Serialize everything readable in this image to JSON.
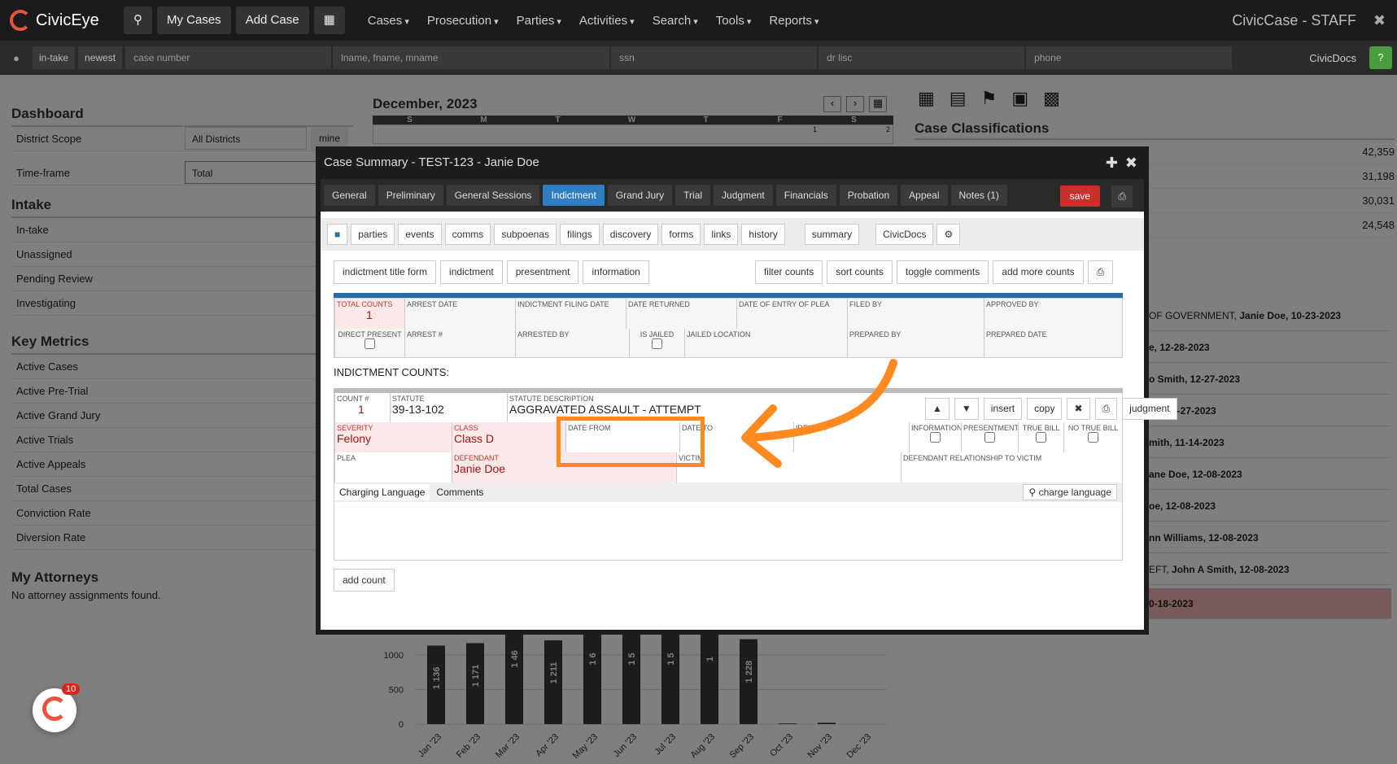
{
  "nav": {
    "brand": "CivicEye",
    "my_cases": "My Cases",
    "add_case": "Add Case",
    "menus": [
      "Cases",
      "Prosecution",
      "Parties",
      "Activities",
      "Search",
      "Tools",
      "Reports"
    ],
    "staff": "CivicCase - STAFF"
  },
  "search": {
    "intake": "in-take",
    "newest": "newest",
    "case_number": "case number",
    "name": "lname, fname, mname",
    "ssn": "ssn",
    "dr": "dr lisc",
    "phone": "phone",
    "civicdocs": "CivicDocs"
  },
  "dashboard": {
    "title": "Dashboard",
    "district_scope": "District Scope",
    "district_value": "All Districts",
    "mine": "mine",
    "timeframe": "Time-frame",
    "timeframe_value": "Total",
    "intake": "Intake",
    "intake_items": [
      "In-take",
      "Unassigned",
      "Pending Review",
      "Investigating"
    ],
    "key_metrics": "Key Metrics",
    "metrics": [
      "Active Cases",
      "Active Pre-Trial",
      "Active Grand Jury",
      "Active Trials",
      "Active Appeals",
      "Total Cases",
      "Conviction Rate",
      "Diversion Rate"
    ],
    "attorneys": "My Attorneys",
    "no_attorneys": "No attorney assignments found."
  },
  "calendar": {
    "month": "December, 2023",
    "days": [
      "S",
      "M",
      "T",
      "W",
      "T",
      "F",
      "S"
    ],
    "dates": [
      "1",
      "2"
    ]
  },
  "right": {
    "classifications": "Case Classifications",
    "values": [
      "42,359",
      "31,198",
      "30,031",
      "24,548"
    ],
    "events": [
      {
        "pre": "OF GOVERNMENT, ",
        "bold": "Janie Doe, 10-23-2023"
      },
      {
        "pre": "",
        "bold": "e, 12-28-2023"
      },
      {
        "pre": "",
        "bold": "o Smith, 12-27-2023"
      },
      {
        "pre": "",
        "bold": "ith, 12-27-2023"
      },
      {
        "pre": "",
        "bold": "mith, 11-14-2023"
      },
      {
        "pre": "",
        "bold": "ane Doe, 12-08-2023"
      },
      {
        "pre": "",
        "bold": "oe, 12-08-2023"
      },
      {
        "pre": "",
        "bold": "nn Williams, 12-08-2023"
      },
      {
        "pre": "EFT, ",
        "bold": "John A Smith, 12-08-2023"
      },
      {
        "pre": "",
        "bold": "0-18-2023"
      }
    ]
  },
  "modal": {
    "title": "Case Summary - TEST-123 - Janie Doe",
    "tabs": [
      "General",
      "Preliminary",
      "General Sessions",
      "Indictment",
      "Grand Jury",
      "Trial",
      "Judgment",
      "Financials",
      "Probation",
      "Appeal",
      "Notes (1)"
    ],
    "save": "save",
    "subtabs": [
      "parties",
      "events",
      "comms",
      "subpoenas",
      "filings",
      "discovery",
      "forms",
      "links",
      "history"
    ],
    "summary": "summary",
    "civicdocs": "CivicDocs",
    "buttons": [
      "indictment title form",
      "indictment",
      "presentment",
      "information"
    ],
    "right_buttons": [
      "filter counts",
      "sort counts",
      "toggle comments",
      "add more counts"
    ],
    "labels": {
      "total_counts": "TOTAL COUNTS",
      "total_value": "1",
      "arrest_date": "ARREST DATE",
      "filing_date": "INDICTMENT FILING DATE",
      "returned": "DATE RETURNED",
      "plea_date": "DATE OF ENTRY OF PLEA",
      "filed_by": "FILED BY",
      "approved_by": "APPROVED BY",
      "direct": "DIRECT PRESENT",
      "arrest_no": "ARREST #",
      "arrested_by": "ARRESTED BY",
      "is_jailed": "IS JAILED",
      "jailed_loc": "JAILED LOCATION",
      "prepared_by": "PREPARED BY",
      "prepared_date": "PREPARED DATE"
    },
    "counts_title": "INDICTMENT COUNTS:",
    "count": {
      "count_label": "COUNT #",
      "count": "1",
      "statute_label": "STATUTE",
      "statute": "39-13-102",
      "desc_label": "STATUTE DESCRIPTION",
      "desc": "AGGRAVATED ASSAULT - ATTEMPT",
      "insert": "insert",
      "copy": "copy",
      "judgment": "judgment",
      "severity_label": "SEVERITY",
      "severity": "Felony",
      "class_label": "CLASS",
      "class": "Class D",
      "date_from": "DATE FROM",
      "date_to": "DATE TO",
      "identifier": "IDENTIFI",
      "information": "INFORMATION",
      "presentment": "PRESENTMENT",
      "true_bill": "TRUE BILL",
      "no_true_bill": "NO TRUE BILL",
      "plea": "PLEA",
      "defendant_label": "DEFENDANT",
      "defendant": "Janie Doe",
      "victim": "VICTIM",
      "relationship": "DEFENDANT RELATIONSHIP TO VICTIM"
    },
    "charging": "Charging Language",
    "comments": "Comments",
    "charge_btn": "charge language",
    "add_count": "add count"
  },
  "chart_data": {
    "type": "bar",
    "categories": [
      "Jan '23",
      "Feb '23",
      "Mar '23",
      "Apr '23",
      "May '23",
      "Jun '23",
      "Jul '23",
      "Aug '23",
      "Sep '23",
      "Oct '23",
      "Nov '23",
      "Dec '23"
    ],
    "values": [
      1136,
      1171,
      1463,
      1211,
      1600,
      1570,
      1570,
      1500,
      1228,
      10,
      20,
      0
    ],
    "labels": [
      "1 136",
      "1 171",
      "1 46",
      "1 211",
      "1 6",
      "1 5",
      "1 5",
      "1",
      "1 228",
      "",
      "",
      ""
    ],
    "yticks": [
      "0",
      "500",
      "1000"
    ]
  },
  "badge": "10"
}
